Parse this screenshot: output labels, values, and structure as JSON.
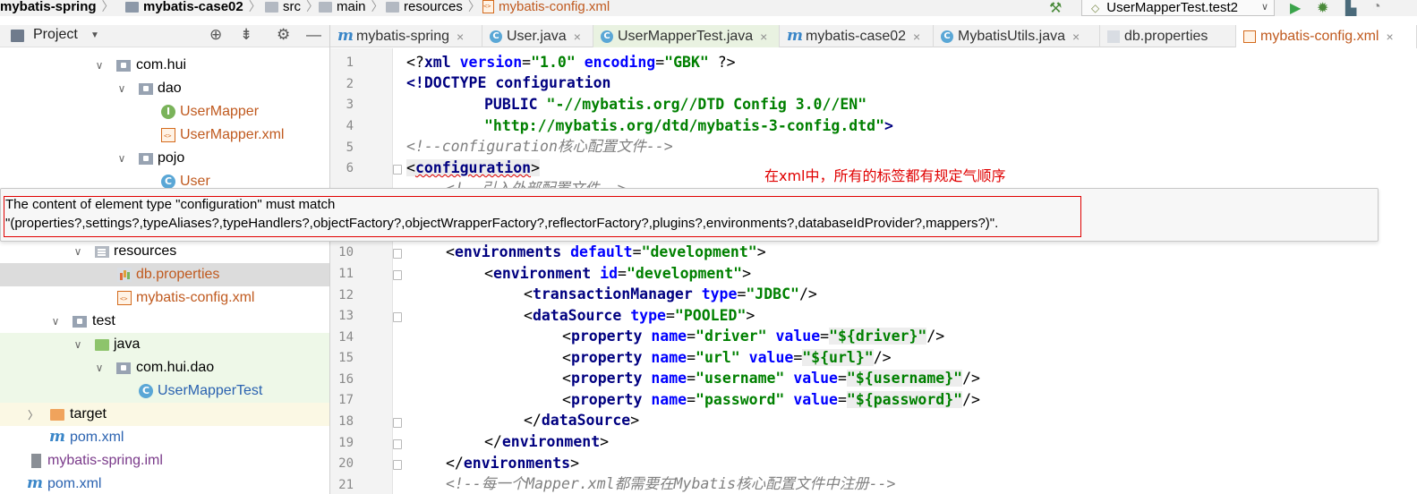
{
  "breadcrumb": {
    "items": [
      "mybatis-spring",
      "mybatis-case02",
      "src",
      "main",
      "resources",
      "mybatis-config.xml"
    ]
  },
  "toolbar": {
    "run_config": "UserMapperTest.test2"
  },
  "project_panel": {
    "title": "Project",
    "tree": [
      {
        "label": "com.hui"
      },
      {
        "label": "dao"
      },
      {
        "label": "UserMapper"
      },
      {
        "label": "UserMapper.xml"
      },
      {
        "label": "pojo"
      },
      {
        "label": "User"
      },
      {
        "label": "resources"
      },
      {
        "label": "db.properties"
      },
      {
        "label": "mybatis-config.xml"
      },
      {
        "label": "test"
      },
      {
        "label": "java"
      },
      {
        "label": "com.hui.dao"
      },
      {
        "label": "UserMapperTest"
      },
      {
        "label": "target"
      },
      {
        "label": "pom.xml"
      },
      {
        "label": "mybatis-spring.iml"
      },
      {
        "label": "pom.xml"
      }
    ]
  },
  "tabs": [
    {
      "label": "mybatis-spring"
    },
    {
      "label": "User.java"
    },
    {
      "label": "UserMapperTest.java"
    },
    {
      "label": "mybatis-case02"
    },
    {
      "label": "MybatisUtils.java"
    },
    {
      "label": "db.properties"
    },
    {
      "label": "mybatis-config.xml"
    }
  ],
  "editor": {
    "line_numbers": [
      "1",
      "2",
      "3",
      "4",
      "5",
      "6",
      "10",
      "11",
      "12",
      "13",
      "14",
      "15",
      "16",
      "17",
      "18",
      "19",
      "20",
      "21"
    ],
    "lines": {
      "l1": [
        "<?",
        "xml ",
        "version",
        "=",
        "\"1.0\"",
        " ",
        "encoding",
        "=",
        "\"GBK\"",
        " ?>"
      ],
      "l2": [
        "<!DOCTYPE ",
        "configuration"
      ],
      "l3": [
        "PUBLIC ",
        "\"-//mybatis.org//DTD Config 3.0//EN\""
      ],
      "l4": [
        "\"http://mybatis.org/dtd/mybatis-3-config.dtd\"",
        ">"
      ],
      "l5": "<!--configuration核心配置文件-->",
      "l6": [
        "<",
        "configuration",
        ">"
      ],
      "l7_partial": "<!--引入外部配置文件-->",
      "l10": [
        "<",
        "environments ",
        "default",
        "=",
        "\"development\"",
        ">"
      ],
      "l11": [
        "<",
        "environment ",
        "id",
        "=",
        "\"development\"",
        ">"
      ],
      "l12": [
        "<",
        "transactionManager ",
        "type",
        "=",
        "\"JDBC\"",
        "/>"
      ],
      "l13": [
        "<",
        "dataSource ",
        "type",
        "=",
        "\"POOLED\"",
        ">"
      ],
      "l14": [
        "<",
        "property ",
        "name",
        "=",
        "\"driver\"",
        " ",
        "value",
        "=",
        "\"${driver}\"",
        "/>"
      ],
      "l15": [
        "<",
        "property ",
        "name",
        "=",
        "\"url\"",
        " ",
        "value",
        "=",
        "\"${url}\"",
        "/>"
      ],
      "l16": [
        "<",
        "property ",
        "name",
        "=",
        "\"username\"",
        " ",
        "value",
        "=",
        "\"${username}\"",
        "/>"
      ],
      "l17": [
        "<",
        "property ",
        "name",
        "=",
        "\"password\"",
        " ",
        "value",
        "=",
        "\"${password}\"",
        "/>"
      ],
      "l18": [
        "</",
        "dataSource",
        ">"
      ],
      "l19": [
        "</",
        "environment",
        ">"
      ],
      "l20": [
        "</",
        "environments",
        ">"
      ],
      "l21_partial": "<!--每一个Mapper.xml都需要在Mybatis核心配置文件中注册-->"
    }
  },
  "annotation": "在xml中，所有的标签都有规定气顺序",
  "tooltip": {
    "line1": "The content of element type \"configuration\" must match",
    "line2": "\"(properties?,settings?,typeAliases?,typeHandlers?,objectFactory?,objectWrapperFactory?,reflectorFactory?,plugins?,environments?,databaseIdProvider?,mappers?)\"."
  },
  "colors": {
    "xml_tag": "#000080",
    "xml_attr": "#0000ff",
    "xml_string": "#008000",
    "comment": "#808080",
    "error": "#e00000"
  }
}
